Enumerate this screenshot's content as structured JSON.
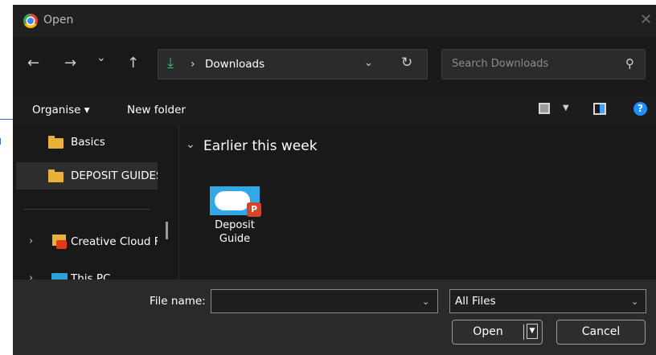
{
  "window": {
    "title": "Open",
    "close_glyph": "✕",
    "app_icon": "chrome-icon"
  },
  "nav": {
    "back_glyph": "←",
    "forward_glyph": "→",
    "recent_glyph": "⌄",
    "up_glyph": "↑",
    "path_icon": "download-icon",
    "path_icon_glyph": "⤓",
    "breadcrumb_sep": "›",
    "breadcrumb": "Downloads",
    "path_dropdown_glyph": "⌄",
    "refresh_glyph": "↻",
    "search_placeholder": "Search Downloads",
    "search_glyph": "⚲"
  },
  "toolbar": {
    "organise_label": "Organise ▾",
    "new_folder_label": "New folder",
    "view_dropdown_glyph": "▼",
    "help_glyph": "?"
  },
  "sidebar": {
    "items": [
      {
        "label": "Basics",
        "icon": "folder-icon",
        "selected": false
      },
      {
        "label": "DEPOSIT GUIDES",
        "icon": "folder-icon",
        "selected": true
      },
      {
        "label": "Creative Cloud Files",
        "icon": "creative-cloud-folder-icon",
        "expander": "›"
      },
      {
        "label": "This PC",
        "icon": "this-pc-icon",
        "expander": "›"
      }
    ]
  },
  "main": {
    "group": {
      "chevron": "⌄",
      "label": "Earlier this week"
    },
    "files": [
      {
        "name_line1": "Deposit",
        "name_line2": "Guide",
        "icon": "powerpoint-icon",
        "badge": "P"
      }
    ]
  },
  "footer": {
    "file_name_label": "File name:",
    "file_name_value": "",
    "file_name_dropdown_glyph": "⌄",
    "file_type_value": "All Files",
    "file_type_dropdown_glyph": "⌄",
    "open_label": "Open",
    "open_drop_glyph": "▼",
    "cancel_label": "Cancel"
  },
  "colors": {
    "accent": "#3da4ff",
    "folder": "#e8b23a",
    "download_green": "#2fbf71",
    "dialog_bg": "#1f1f1f"
  }
}
